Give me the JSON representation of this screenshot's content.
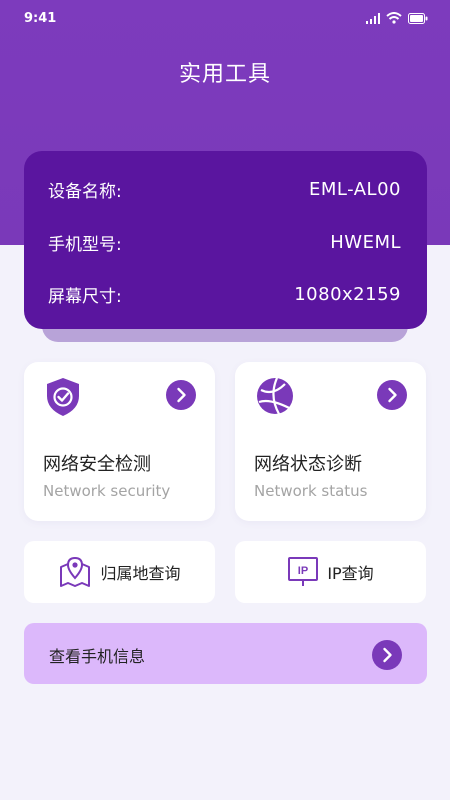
{
  "status_bar": {
    "time": "9:41",
    "icons": [
      "signal-icon",
      "wifi-icon",
      "battery-icon"
    ]
  },
  "header": {
    "title": "实用工具"
  },
  "device": {
    "rows": [
      {
        "label": "设备名称:",
        "value": "EML-AL00"
      },
      {
        "label": "手机型号:",
        "value": "HWEML"
      },
      {
        "label": "屏幕尺寸:",
        "value": "1080x2159"
      }
    ]
  },
  "tools": [
    {
      "name_cn": "网络安全检测",
      "name_en": "Network security",
      "icon": "shield-check-icon"
    },
    {
      "name_cn": "网络状态诊断",
      "name_en": "Network status",
      "icon": "globe-icon"
    }
  ],
  "quick": [
    {
      "label": "归属地查询",
      "icon": "map-pin-icon"
    },
    {
      "label": "IP查询",
      "icon": "ip-icon",
      "icon_text": "IP"
    }
  ],
  "info_bar": {
    "label": "查看手机信息"
  },
  "colors": {
    "accent": "#7a39b9",
    "card": "#5a159f",
    "info_bar": "#dcb8fb",
    "background": "#f3f2fb"
  }
}
